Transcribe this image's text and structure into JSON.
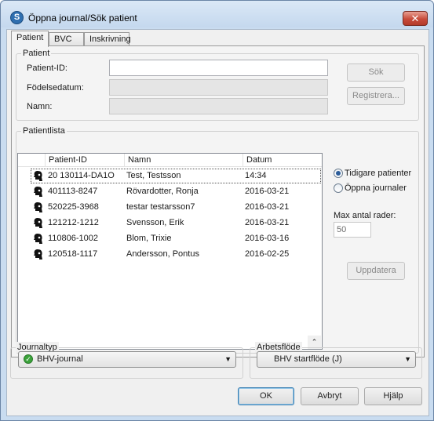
{
  "window": {
    "title": "Öppna journal/Sök patient",
    "close_glyph": "✕"
  },
  "tabs": [
    {
      "label": "Patient",
      "active": true
    },
    {
      "label": "BVC",
      "active": false
    },
    {
      "label": "Inskrivning",
      "active": false
    }
  ],
  "patient_group": {
    "legend": "Patient",
    "patient_id_label": "Patient-ID:",
    "patient_id_value": "",
    "birthdate_label": "Födelsedatum:",
    "birthdate_value": "",
    "name_label": "Namn:",
    "name_value": "",
    "search_button": "Sök",
    "register_button": "Registrera..."
  },
  "patient_list": {
    "legend": "Patientlista",
    "columns": [
      "Patient-ID",
      "Namn",
      "Datum"
    ],
    "rows": [
      {
        "id": "20 130114-DA1O",
        "name": "Test, Testsson",
        "date": "14:34",
        "selected": true
      },
      {
        "id": "401113-8247",
        "name": "Rövardotter, Ronja",
        "date": "2016-03-21",
        "selected": false
      },
      {
        "id": "520225-3968",
        "name": "testar testarsson7",
        "date": "2016-03-21",
        "selected": false
      },
      {
        "id": "121212-1212",
        "name": "Svensson, Erik",
        "date": "2016-03-21",
        "selected": false
      },
      {
        "id": "110806-1002",
        "name": "Blom, Trixie",
        "date": "2016-03-16",
        "selected": false
      },
      {
        "id": "120518-1117",
        "name": "Andersson, Pontus",
        "date": "2016-02-25",
        "selected": false
      }
    ],
    "row_icon": "patient-head-icon",
    "scroll_glyph": "⌃"
  },
  "options": {
    "radio_previous": "Tidigare patienter",
    "radio_open": "Öppna journaler",
    "selected_radio": "previous",
    "max_rows_label": "Max antal rader:",
    "max_rows_value": "50",
    "update_button": "Uppdatera"
  },
  "journal_type": {
    "legend": "Journaltyp",
    "selected": "BHV-journal",
    "status_icon": "green-check-icon"
  },
  "workflow": {
    "legend": "Arbetsflöde",
    "selected": "BHV startflöde (J)"
  },
  "footer": {
    "ok_button": "OK",
    "cancel_button": "Avbryt",
    "help_button": "Hjälp"
  },
  "colors": {
    "window_frame": "#c9dcf0",
    "close_button": "#c74b3a",
    "selected_radio": "#2c5d9a",
    "check_green": "#3ba33b"
  }
}
